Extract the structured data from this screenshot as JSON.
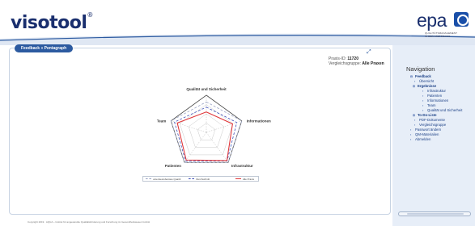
{
  "header": {
    "brand": "visotool",
    "brand_mark": "®",
    "epa_logo": "epa",
    "epa_tagline_1": "QUALITÄTSMANAGEMENT",
    "epa_tagline_2": "IN DER ARZTPRAXIS"
  },
  "main": {
    "breadcrumb": "Feedback » Pentagraph",
    "praxis_id_label": "Praxis-ID:",
    "praxis_id_value": "11720",
    "vergleich_label": "Vergleichsgruppe:",
    "vergleich_value": "Alle Praxen"
  },
  "chart_data": {
    "type": "radar",
    "axes": [
      "Qualität und Sicherheit",
      "Informationen",
      "Infrastruktur",
      "Patienten",
      "Team"
    ],
    "levels": 4,
    "series": [
      {
        "name": "Alle Praxis",
        "color": "#e0383b",
        "style": "solid",
        "values": [
          0.55,
          0.74,
          0.94,
          0.92,
          0.82
        ]
      },
      {
        "name": "Durchschnitt",
        "color": "#3d4fb8",
        "style": "dashed",
        "values": [
          0.68,
          0.86,
          0.95,
          0.95,
          0.9
        ]
      },
      {
        "name": "unterstes/oberstes Quartil",
        "color": "#9aa3c4",
        "style": "dashed",
        "values": [
          0.82,
          1.0,
          1.0,
          1.0,
          1.0
        ]
      }
    ],
    "legend": [
      "unterstes/oberstes Quartil",
      "Durchschnitt",
      "Alle Praxis"
    ]
  },
  "footer": {
    "copyright": "Copyright 2019 · AQUA – Institut für angewandte Qualitätsförderung und Forschung im Gesundheitswesen GmbH"
  },
  "sidebar": {
    "title": "Navigation",
    "items": [
      {
        "label": "Feedback",
        "mark": "⊟"
      },
      {
        "label": "Übersicht",
        "mark": "▪"
      },
      {
        "label": "Ergebnisse",
        "mark": "⊟"
      },
      {
        "label": "Infrastruktur",
        "mark": "▪"
      },
      {
        "label": "Patienten",
        "mark": "▪"
      },
      {
        "label": "Informationen",
        "mark": "▪"
      },
      {
        "label": "Team",
        "mark": "▪"
      },
      {
        "label": "Qualität und Sicherheit",
        "mark": "▪"
      },
      {
        "label": "To-Do-Liste",
        "mark": "⊟"
      },
      {
        "label": "PDF-Dokumente",
        "mark": "▪"
      },
      {
        "label": "Vergleichsgruppe",
        "mark": "▪"
      },
      {
        "label": "Passwort ändern",
        "mark": "▪"
      },
      {
        "label": "QM-Materialien",
        "mark": "▪"
      },
      {
        "label": "Abmelden",
        "mark": "▪"
      }
    ]
  }
}
